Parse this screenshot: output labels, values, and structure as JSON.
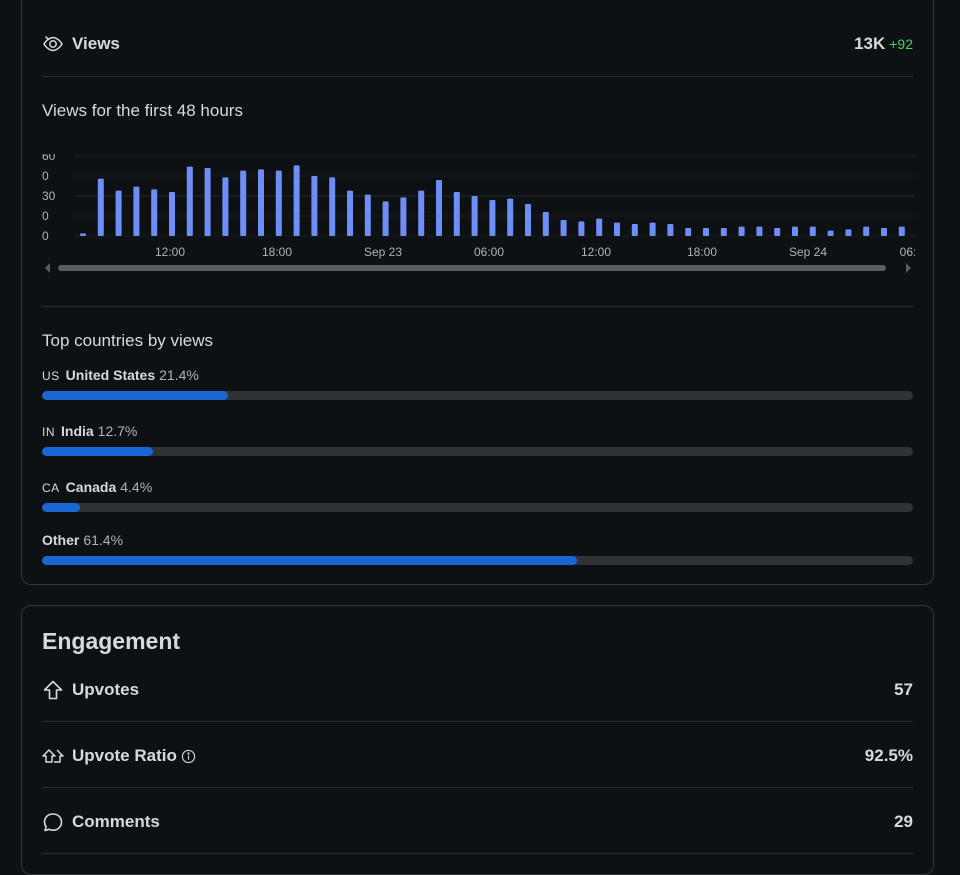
{
  "views": {
    "label": "Views",
    "value": "13K",
    "delta": "+92"
  },
  "chart_section_title": "Views for the first 48 hours",
  "chart_data": {
    "type": "bar",
    "y_tick_labels": [
      "60",
      "0",
      "30",
      "0",
      "0"
    ],
    "x_tick_labels": [
      "12:00",
      "18:00",
      "Sep 23",
      "06:00",
      "12:00",
      "18:00",
      "Sep 24",
      "06:"
    ],
    "grid": true,
    "color": "#6d8ef6",
    "values": [
      2,
      43,
      34,
      37,
      35,
      33,
      52,
      51,
      44,
      49,
      50,
      49,
      53,
      45,
      44,
      34,
      31,
      26,
      29,
      34,
      42,
      33,
      30,
      27,
      28,
      24,
      18,
      12,
      11,
      13,
      10,
      9,
      10,
      9,
      6,
      6,
      6,
      7,
      7,
      6,
      7,
      7,
      4,
      5,
      7,
      6,
      7,
      9
    ]
  },
  "countries_title": "Top countries by views",
  "countries": [
    {
      "code": "US",
      "name": "United States",
      "pct": "21.4%",
      "value": 21.4
    },
    {
      "code": "IN",
      "name": "India",
      "pct": "12.7%",
      "value": 12.7
    },
    {
      "code": "CA",
      "name": "Canada",
      "pct": "4.4%",
      "value": 4.4
    },
    {
      "code": "",
      "name": "Other",
      "pct": "61.4%",
      "value": 61.4
    }
  ],
  "engagement": {
    "title": "Engagement",
    "upvotes": {
      "label": "Upvotes",
      "value": "57"
    },
    "ratio": {
      "label": "Upvote Ratio",
      "value": "92.5%"
    },
    "comments": {
      "label": "Comments",
      "value": "29"
    }
  },
  "colors": {
    "accent": "#1a66d3",
    "bar": "#6d8ef6",
    "positive": "#46d160",
    "track": "#2f3335"
  }
}
